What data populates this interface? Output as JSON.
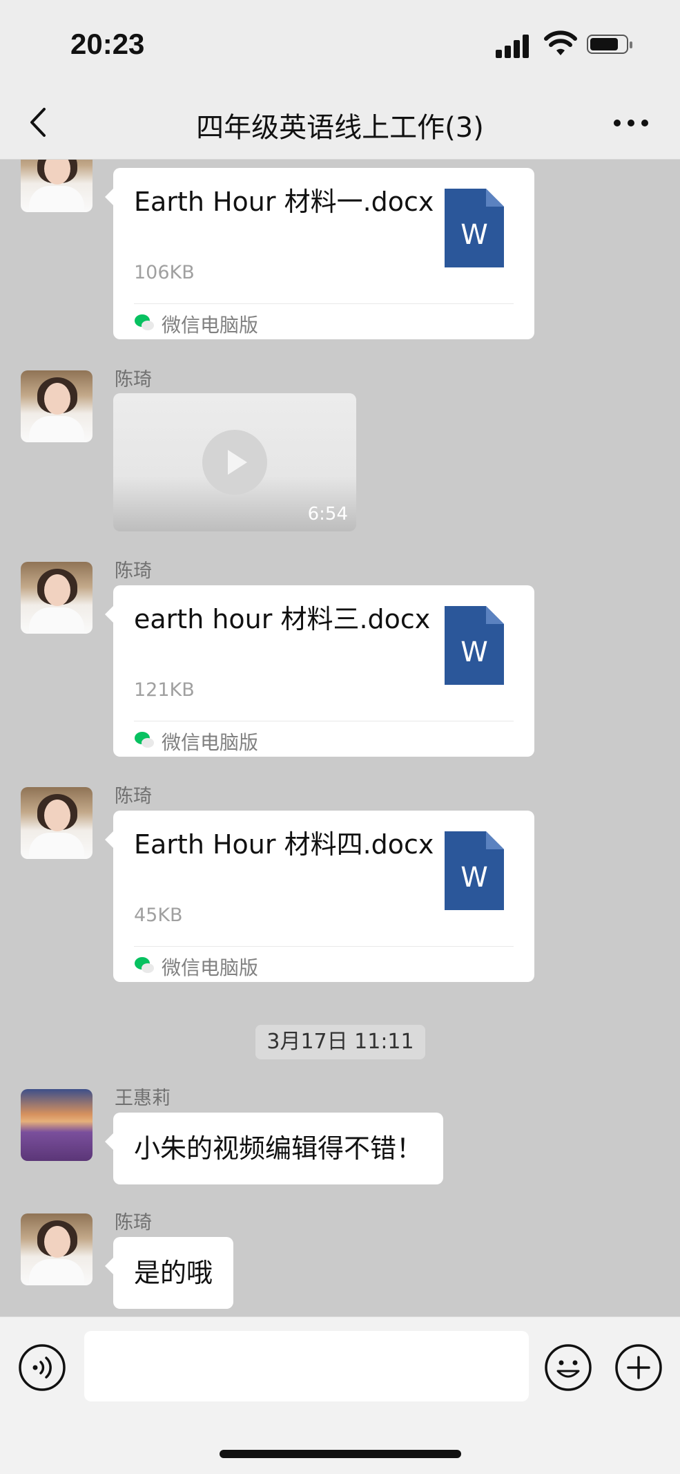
{
  "status": {
    "time": "20:23"
  },
  "header": {
    "title": "四年级英语线上工作(3)"
  },
  "messages": [
    {
      "type": "file",
      "file_name": "Earth Hour 材料一.docx",
      "size": "106KB",
      "source": "微信电脑版",
      "file_icon": "word-doc-icon",
      "file_icon_letter": "W"
    },
    {
      "type": "video",
      "sender": "陈琦",
      "duration": "6:54"
    },
    {
      "type": "file",
      "sender": "陈琦",
      "file_name": "earth hour 材料三.docx",
      "size": "121KB",
      "source": "微信电脑版",
      "file_icon_letter": "W"
    },
    {
      "type": "file",
      "sender": "陈琦",
      "file_name": "Earth Hour 材料四.docx",
      "size": "45KB",
      "source": "微信电脑版",
      "file_icon_letter": "W"
    },
    {
      "type": "time",
      "text": "3月17日 11:11"
    },
    {
      "type": "text",
      "sender": "王惠莉",
      "text": "小朱的视频编辑得不错！"
    },
    {
      "type": "text",
      "sender": "陈琦",
      "text": "是的哦"
    }
  ],
  "colors": {
    "word_blue": "#2b579a",
    "chat_bg": "#cacaca",
    "bar_bg": "#ededed",
    "wechat_green": "#07c160"
  },
  "icons": [
    "back-icon",
    "more-icon",
    "word-doc-icon",
    "play-icon",
    "wechat-icon",
    "voice-icon",
    "emoji-icon",
    "plus-icon"
  ]
}
